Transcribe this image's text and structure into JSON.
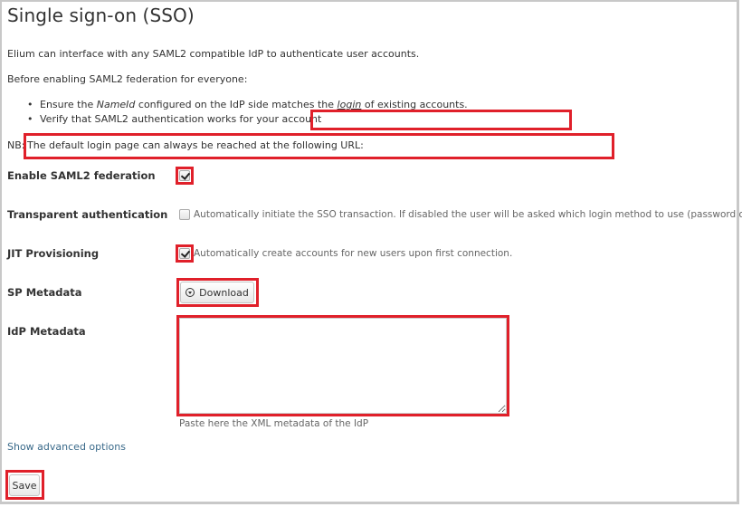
{
  "page": {
    "title": "Single sign-on (SSO)",
    "intro": "Elium can interface with any SAML2 compatible IdP to authenticate user accounts.",
    "before_heading": "Before enabling SAML2 federation for everyone:",
    "bullets": [
      {
        "part1": "Ensure the ",
        "em": "NameId",
        "part2": " configured on the IdP side matches the ",
        "link": "login",
        "part3": " of existing accounts."
      },
      {
        "text": "Verify that SAML2 authentication works for your account"
      }
    ],
    "nb_prefix": "NB:",
    "nb_text": "The default login page can always be reached at the following URL:"
  },
  "form": {
    "enable_saml2": {
      "label": "Enable SAML2 federation",
      "checked": true
    },
    "transparent_auth": {
      "label": "Transparent authentication",
      "checked": false,
      "help": "Automatically initiate the SSO transaction. If disabled the user will be asked which login method to use (password or SSO)."
    },
    "jit": {
      "label": "JIT Provisioning",
      "checked": true,
      "help": "Automatically create accounts for new users upon first connection."
    },
    "sp_metadata": {
      "label": "SP Metadata",
      "button": "Download",
      "icon": "download-circle-icon"
    },
    "idp_metadata": {
      "label": "IdP Metadata",
      "value": "",
      "help": "Paste here the XML metadata of the IdP"
    },
    "advanced_link": "Show advanced options",
    "save_button": "Save"
  },
  "colors": {
    "highlight": "#e0202a",
    "link": "#3a6a8a"
  }
}
